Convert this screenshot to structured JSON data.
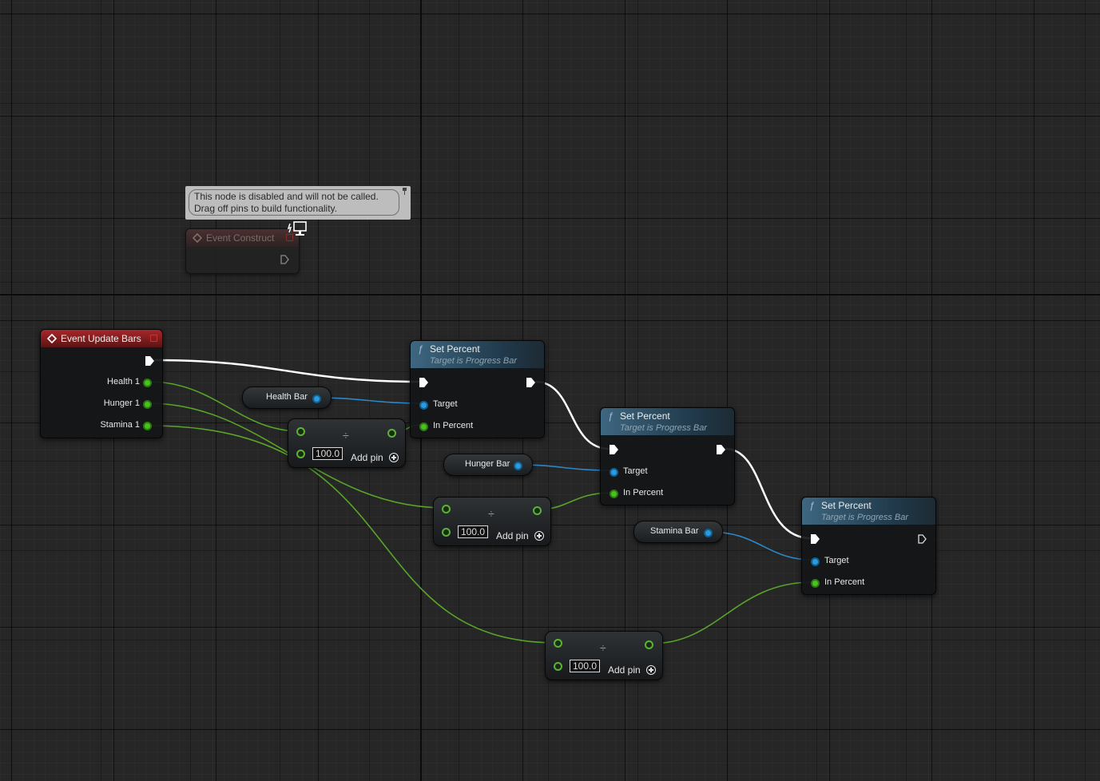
{
  "comment": {
    "line1": "This node is disabled and will not be called.",
    "line2": "Drag off pins to build functionality."
  },
  "event_construct": {
    "title": "Event Construct"
  },
  "event_update_bars": {
    "title": "Event Update Bars",
    "pins": [
      "Health 1",
      "Hunger 1",
      "Stamina 1"
    ]
  },
  "variables": {
    "health_bar": "Health Bar",
    "hunger_bar": "Hunger Bar",
    "stamina_bar": "Stamina Bar"
  },
  "set_percent_nodes": [
    {
      "title": "Set Percent",
      "subtitle": "Target is Progress Bar",
      "target": "Target",
      "in_percent": "In Percent"
    },
    {
      "title": "Set Percent",
      "subtitle": "Target is Progress Bar",
      "target": "Target",
      "in_percent": "In Percent"
    },
    {
      "title": "Set Percent",
      "subtitle": "Target is Progress Bar",
      "target": "Target",
      "in_percent": "In Percent"
    }
  ],
  "divide_nodes": [
    {
      "divisor": "100.0",
      "add_pin": "Add pin",
      "symbol": "÷"
    },
    {
      "divisor": "100.0",
      "add_pin": "Add pin",
      "symbol": "÷"
    },
    {
      "divisor": "100.0",
      "add_pin": "Add pin",
      "symbol": "÷"
    }
  ],
  "colors": {
    "event_header": "#a8272a",
    "function_header": "#3e6780",
    "exec_wire": "#ffffff",
    "float_wire": "#5fb52a",
    "object_wire": "#2a9be0",
    "grid_background": "#262626"
  },
  "icons": [
    "event-diamond-icon",
    "function-f-icon",
    "exec-pin-icon",
    "plus-circle-icon",
    "monitor-icon",
    "pin-tack-icon",
    "divide-icon"
  ]
}
